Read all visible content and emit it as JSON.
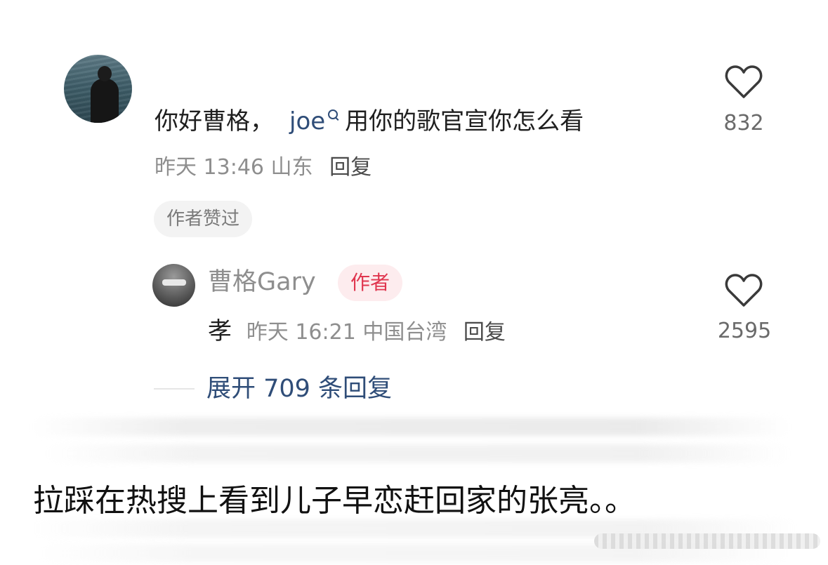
{
  "comment": {
    "text_before": "你好曹格，",
    "mention": "joe",
    "text_after": "用你的歌官宣你怎么看",
    "time": "昨天 13:46",
    "location": "山东",
    "reply_label": "回复",
    "liked_by_author_badge": "作者赞过",
    "like_count": "832",
    "heart_icon": "heart-outline-icon"
  },
  "reply": {
    "author_name": "曹格Gary",
    "author_tag": "作者",
    "text": "孝",
    "time": "昨天 16:21",
    "location": "中国台湾",
    "reply_label": "回复",
    "like_count": "2595",
    "heart_icon": "heart-outline-icon"
  },
  "expand": {
    "label": "展开 709 条回复"
  },
  "caption": "拉踩在热搜上看到儿子早恋赶回家的张亮。。",
  "colors": {
    "link_blue": "#2f4d78",
    "author_tag_red": "#e0364f",
    "author_tag_bg": "#fdecee",
    "muted_gray": "#8e8e8e"
  }
}
